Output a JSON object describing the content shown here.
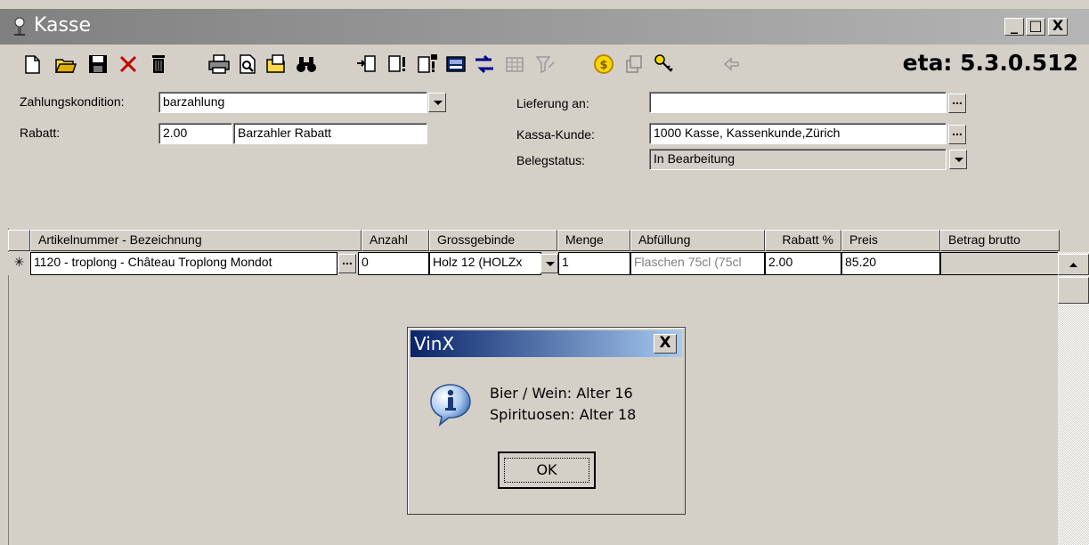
{
  "window": {
    "title": "Kasse",
    "minimize": "_",
    "maximize": "□",
    "close": "X"
  },
  "toolbar": {
    "version": "eta: 5.3.0.512",
    "icons": [
      "new-document-icon",
      "open-folder-icon",
      "save-disk-icon",
      "delete-x-icon",
      "trash-icon",
      "print-icon",
      "print-preview-icon",
      "copy-icon",
      "find-binoculars-icon",
      "import-icon",
      "document-alert-icon",
      "document-ep-icon",
      "calculator-icon",
      "transfer-arrows-icon",
      "disabled-grid-icon",
      "disabled-filter-icon",
      "coin-icon",
      "disabled-stack-icon",
      "key-icon",
      "disabled-arrow-icon"
    ]
  },
  "form": {
    "zahlungskondition_label": "Zahlungskondition:",
    "zahlungskondition_value": "barzahlung",
    "rabatt_label": "Rabatt:",
    "rabatt_value": "2.00",
    "rabatt_text": "Barzahler Rabatt",
    "lieferung_label": "Lieferung an:",
    "lieferung_value": "",
    "kunde_label": "Kassa-Kunde:",
    "kunde_value": "1000 Kasse, Kassenkunde,Zürich",
    "belegstatus_label": "Belegstatus:",
    "belegstatus_value": "In Bearbeitung"
  },
  "table": {
    "headers": [
      "Artikelnummer - Bezeichnung",
      "Anzahl",
      "Grossgebinde",
      "Menge",
      "Abfüllung",
      "Rabatt %",
      "Preis",
      "Betrag brutto"
    ],
    "row": {
      "marker": "✳",
      "artikel": "1120 - troplong - Château Troplong Mondot",
      "anzahl": "0",
      "grossgebinde": "Holz 12 (HOLZx",
      "menge": "1",
      "abfuellung": "Flaschen 75cl (75cl",
      "rabatt": "2.00",
      "preis": "85.20",
      "betrag": ""
    }
  },
  "dialog": {
    "title": "VinX",
    "line1": "Bier / Wein: Alter 16",
    "line2": "Spirituosen: Alter 18",
    "ok_label": "OK",
    "close": "X"
  },
  "colors": {
    "face": "#d4d0c8",
    "dialog_title_start": "#0a246a",
    "dialog_title_end": "#a6caf0"
  }
}
